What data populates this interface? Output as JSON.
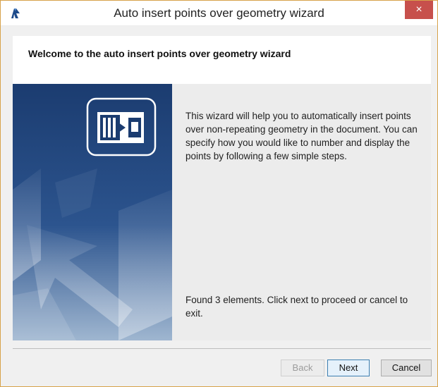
{
  "window": {
    "title": "Auto insert points over geometry wizard",
    "close_glyph": "×",
    "app_icon": "revit-logo-icon"
  },
  "header": {
    "title": "Welcome to the auto insert points over geometry wizard"
  },
  "content": {
    "description": "This wizard will help you to automatically insert points over non-repeating geometry in the document. You can specify how you would like to number and display the points by following a few simple steps.",
    "status": "Found 3 elements. Click next to proceed or cancel to exit.",
    "side_icon": "wizard-insert-icon"
  },
  "buttons": {
    "back": "Back",
    "next": "Next",
    "cancel": "Cancel"
  },
  "colors": {
    "close_bg": "#c7504c",
    "banner_dark": "#1c3f74",
    "accent_border": "#3c7fb1"
  }
}
